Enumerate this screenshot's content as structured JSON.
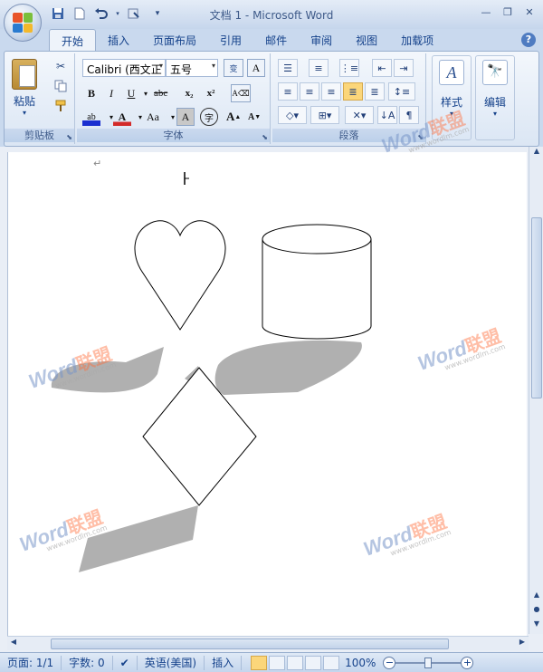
{
  "titlebar": {
    "title": "文档 1 - Microsoft Word",
    "quick_access": [
      "save-icon",
      "new-document-icon",
      "undo-icon",
      "repeat-icon",
      "customize-dropdown-icon"
    ]
  },
  "tabs": [
    {
      "label": "开始",
      "active": true
    },
    {
      "label": "插入"
    },
    {
      "label": "页面布局"
    },
    {
      "label": "引用"
    },
    {
      "label": "邮件"
    },
    {
      "label": "审阅"
    },
    {
      "label": "视图"
    },
    {
      "label": "加载项"
    }
  ],
  "ribbon": {
    "clipboard": {
      "paste_label": "粘贴",
      "group_label": "剪贴板"
    },
    "font": {
      "font_name": "Calibri (西文正",
      "font_size": "五号",
      "wen_label": "wén\n变",
      "a_box": "A",
      "bold": "B",
      "italic": "I",
      "underline": "U",
      "strike": "abc",
      "subscript": "x₂",
      "superscript": "x²",
      "grow": "A",
      "shrink": "A",
      "aa": "Aa",
      "char_shade": "A",
      "enclose": "字",
      "group_label": "字体"
    },
    "paragraph": {
      "group_label": "段落"
    },
    "styles": {
      "label": "样式"
    },
    "editing": {
      "label": "编辑"
    }
  },
  "document": {
    "paragraph_mark": "↵"
  },
  "watermarks": [
    {
      "w1": "Word",
      "w2": "联盟",
      "w3": "www.wordlm.com"
    }
  ],
  "statusbar": {
    "page": "页面: 1/1",
    "words": "字数: 0",
    "language": "英语(美国)",
    "insert_mode": "插入",
    "zoom": "100%",
    "zoom_level": 0.5
  },
  "colors": {
    "shape_shadow": "#b0b0b0",
    "ribbon_bg": "#dbe6f4",
    "accent": "#15428b",
    "highlight_yellow": "#fbd67a"
  }
}
